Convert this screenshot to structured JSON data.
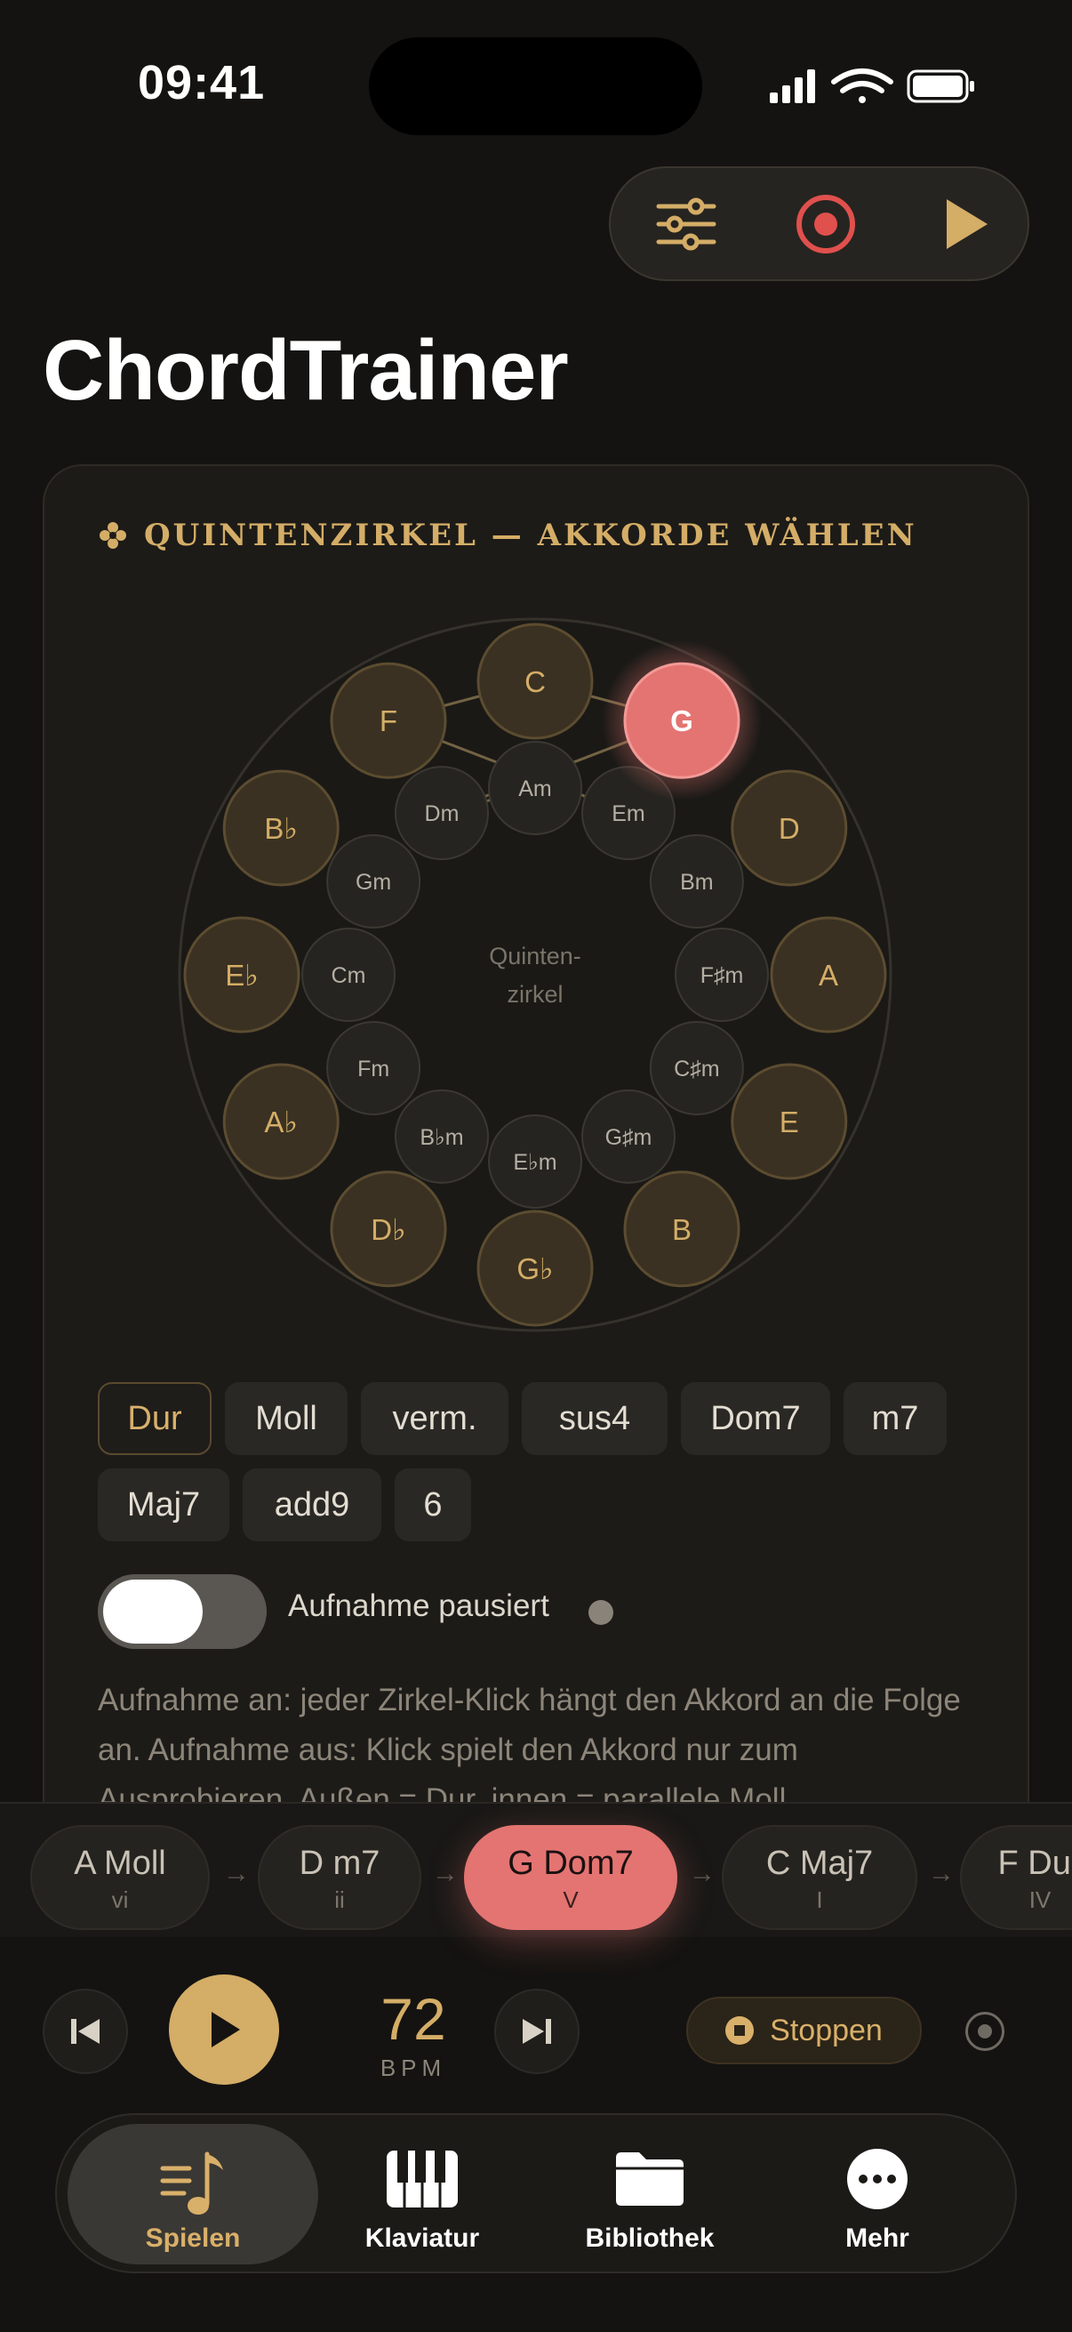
{
  "status": {
    "time": "09:41"
  },
  "app": {
    "title": "ChordTrainer"
  },
  "colors": {
    "accent": "#d4ad67",
    "highlight": "#e47471"
  },
  "toolbar": {
    "icons": [
      "sliders-icon",
      "record-icon",
      "play-icon"
    ]
  },
  "circle": {
    "heading": "QUINTENZIRKEL — AKKORDE WÄHLEN",
    "center_line1": "Quinten-",
    "center_line2": "zirkel",
    "selected": "G",
    "major": [
      "C",
      "G",
      "D",
      "A",
      "E",
      "B",
      "G♭",
      "D♭",
      "A♭",
      "E♭",
      "B♭",
      "F"
    ],
    "minor": [
      "Am",
      "Em",
      "Bm",
      "F♯m",
      "C♯m",
      "G♯m",
      "E♭m",
      "B♭m",
      "Fm",
      "Cm",
      "Gm",
      "Dm"
    ]
  },
  "qualities": {
    "items": [
      "Dur",
      "Moll",
      "verm.",
      "sus4",
      "Dom7",
      "m7",
      "Maj7",
      "add9",
      "6"
    ],
    "selected": "Dur"
  },
  "recording": {
    "label": "Aufnahme pausiert",
    "enabled": false,
    "help": "Aufnahme an: jeder Zirkel-Klick hängt den Akkord an die Folge an. Aufnahme aus: Klick spielt den Akkord nur zum Ausprobieren. Außen = Dur, innen = parallele Moll."
  },
  "progression": [
    {
      "name": "A Moll",
      "roman": "vi"
    },
    {
      "name": "D m7",
      "roman": "ii"
    },
    {
      "name": "G Dom7",
      "roman": "V",
      "active": true
    },
    {
      "name": "C Maj7",
      "roman": "I"
    },
    {
      "name": "F Dur",
      "roman": "IV"
    }
  ],
  "transport": {
    "bpm": "72",
    "bpm_label": "BPM",
    "stop_label": "Stoppen"
  },
  "tabs": [
    {
      "label": "Spielen",
      "icon": "music-note-list-icon",
      "active": true
    },
    {
      "label": "Klaviatur",
      "icon": "piano-keys-icon"
    },
    {
      "label": "Bibliothek",
      "icon": "folder-icon"
    },
    {
      "label": "Mehr",
      "icon": "more-icon"
    }
  ]
}
